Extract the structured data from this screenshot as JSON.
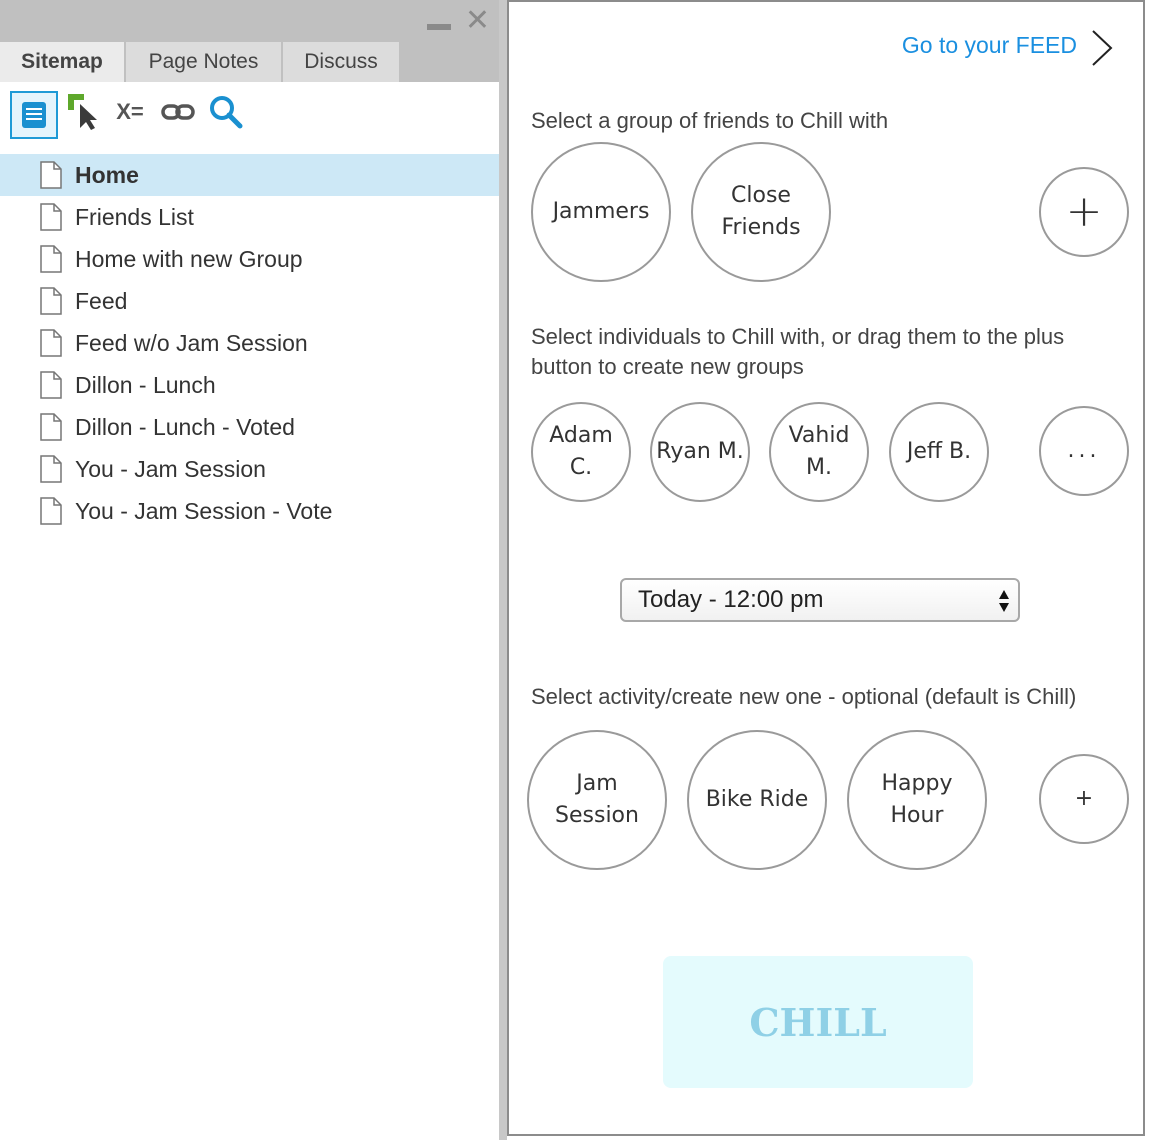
{
  "sidebar": {
    "tabs": [
      {
        "label": "Sitemap",
        "active": true
      },
      {
        "label": "Page Notes",
        "active": false
      },
      {
        "label": "Discuss",
        "active": false
      }
    ],
    "toolbar": {
      "pages_icon": "pages-icon",
      "cursor_icon": "cursor-arrow-icon",
      "variables_label": "X=",
      "link_icon": "link-icon",
      "search_icon": "search-icon"
    },
    "pages": [
      {
        "label": "Home",
        "selected": true
      },
      {
        "label": "Friends List",
        "selected": false
      },
      {
        "label": "Home with new Group",
        "selected": false
      },
      {
        "label": "Feed",
        "selected": false
      },
      {
        "label": "Feed w/o Jam Session",
        "selected": false
      },
      {
        "label": "Dillon - Lunch",
        "selected": false
      },
      {
        "label": "Dillon - Lunch - Voted",
        "selected": false
      },
      {
        "label": "You - Jam Session",
        "selected": false
      },
      {
        "label": "You - Jam Session - Vote",
        "selected": false
      }
    ]
  },
  "prototype": {
    "feed_link": "Go to your FEED",
    "groups_label": "Select a group of friends to Chill with",
    "groups": [
      {
        "line1": "Jammers",
        "line2": ""
      },
      {
        "line1": "Close",
        "line2": "Friends"
      }
    ],
    "add_group_label": "+",
    "individuals_label_line1": "Select individuals to Chill with, or drag them to the plus",
    "individuals_label_line2": "button to create new groups",
    "individuals": [
      {
        "line1": "Adam",
        "line2": "C."
      },
      {
        "line1": "Ryan M.",
        "line2": ""
      },
      {
        "line1": "Vahid",
        "line2": "M."
      },
      {
        "line1": "Jeff B.",
        "line2": ""
      }
    ],
    "more_label": "...",
    "time_select": {
      "value": "Today - 12:00 pm"
    },
    "activity_label": "Select activity/create new one - optional (default is Chill)",
    "activities": [
      {
        "line1": "Jam",
        "line2": "Session"
      },
      {
        "line1": "Bike Ride",
        "line2": ""
      },
      {
        "line1": "Happy",
        "line2": "Hour"
      }
    ],
    "add_activity_label": "+",
    "chill_button": "CHILL"
  },
  "colors": {
    "accent_blue": "#1a8fe0",
    "selected_row": "#cde8f6",
    "chill_bg": "#e4fbfd",
    "chill_text": "#8fd0e6"
  }
}
